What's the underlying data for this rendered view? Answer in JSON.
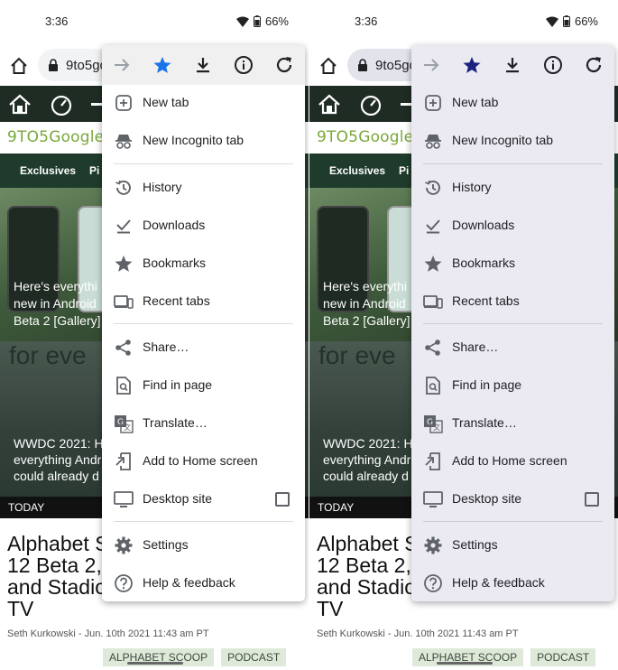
{
  "status": {
    "time": "3:36",
    "battery": "66%"
  },
  "urlbar": {
    "url": "9to5goo"
  },
  "site": {
    "logo": "9TO5Google",
    "categories": [
      "Exclusives",
      "Pi"
    ],
    "hero1_lines": [
      "Here's everythi",
      "new in Android",
      "Beta 2 [Gallery]"
    ],
    "hero2_big": "for eve",
    "hero2_lines": [
      "WWDC 2021: H",
      "everything Andr",
      "could already d"
    ],
    "today": "TODAY",
    "article_lines": [
      "Alphabet S",
      "12 Beta 2,",
      "and Stadio",
      "TV"
    ],
    "byline": "Seth Kurkowski  - Jun. 10th 2021 11:43 am PT",
    "tags": [
      "ALPHABET SCOOP",
      "PODCAST"
    ]
  },
  "menu": {
    "top_icons": [
      "forward-icon",
      "star-icon",
      "download-icon",
      "info-icon",
      "refresh-icon"
    ],
    "items": [
      {
        "label": "New tab",
        "icon": "new-tab-icon"
      },
      {
        "label": "New Incognito tab",
        "icon": "incognito-icon"
      },
      {
        "label": "History",
        "icon": "history-icon"
      },
      {
        "label": "Downloads",
        "icon": "downloads-icon"
      },
      {
        "label": "Bookmarks",
        "icon": "bookmarks-icon"
      },
      {
        "label": "Recent tabs",
        "icon": "recent-tabs-icon"
      },
      {
        "label": "Share…",
        "icon": "share-icon"
      },
      {
        "label": "Find in page",
        "icon": "find-icon"
      },
      {
        "label": "Translate…",
        "icon": "translate-icon"
      },
      {
        "label": "Add to Home screen",
        "icon": "add-home-icon"
      },
      {
        "label": "Desktop site",
        "icon": "desktop-icon"
      },
      {
        "label": "Settings",
        "icon": "settings-icon"
      },
      {
        "label": "Help & feedback",
        "icon": "help-icon"
      }
    ]
  },
  "colors": {
    "star_light": "#1a73e8",
    "star_dark": "#1a237e",
    "menu_dark_bg": "#ebe9f1",
    "site_green": "#1f3b2c"
  }
}
